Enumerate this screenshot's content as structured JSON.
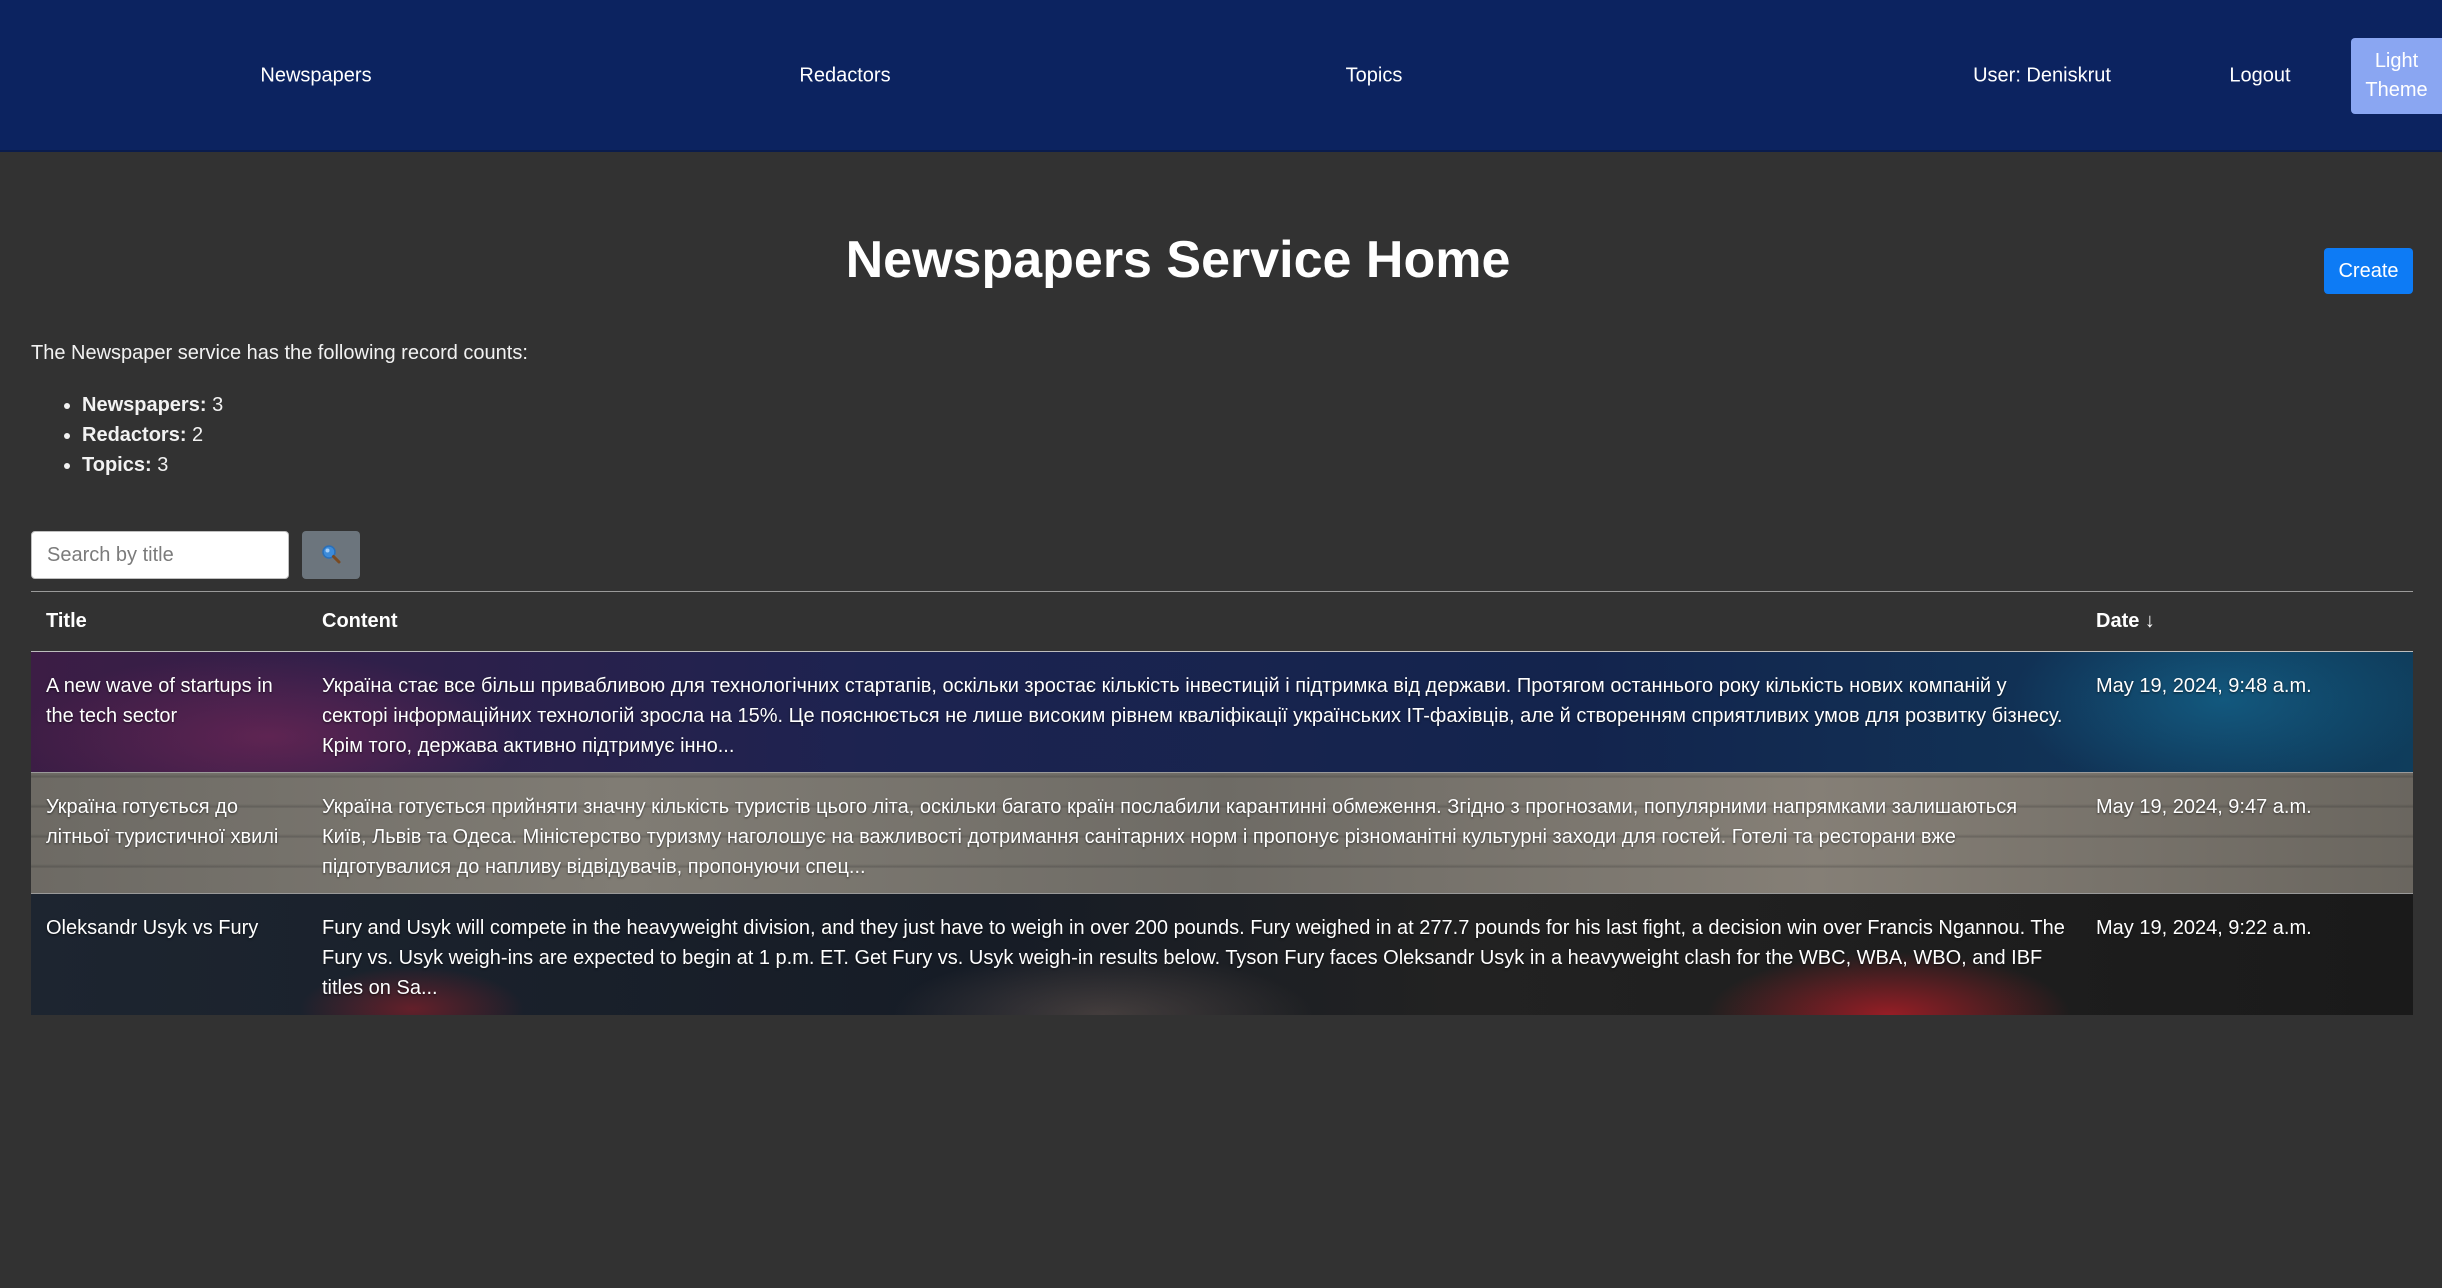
{
  "nav": {
    "newspapers": "Newspapers",
    "redactors": "Redactors",
    "topics": "Topics",
    "user": "User: Deniskrut",
    "logout": "Logout",
    "theme_line1": "Light",
    "theme_line2": "Theme"
  },
  "header": {
    "title": "Newspapers Service Home",
    "create": "Create"
  },
  "intro": "The Newspaper service has the following record counts:",
  "counts": [
    {
      "label": "Newspapers:",
      "value": "3"
    },
    {
      "label": "Redactors:",
      "value": "2"
    },
    {
      "label": "Topics:",
      "value": "3"
    }
  ],
  "search": {
    "placeholder": "Search by title",
    "button_icon": "search-icon"
  },
  "table": {
    "columns": [
      "Title",
      "Content",
      "Date ↓"
    ],
    "rows": [
      {
        "title": "A new wave of startups in the tech sector",
        "content": "Україна стає все більш привабливою для технологічних стартапів, оскільки зростає кількість інвестицій і підтримка від держави. Протягом останнього року кількість нових компаній у секторі інформаційних технологій зросла на 15%. Це пояснюється не лише високим рівнем кваліфікації українських IT-фахівців, але й створенням сприятливих умов для розвитку бізнесу. Крім того, держава активно підтримує інно...",
        "date": "May 19, 2024, 9:48 a.m."
      },
      {
        "title": "Україна готується до літньої туристичної хвилі",
        "content": "Україна готується прийняти значну кількість туристів цього літа, оскільки багато країн послабили карантинні обмеження. Згідно з прогнозами, популярними напрямками залишаються Київ, Львів та Одеса. Міністерство туризму наголошує на важливості дотримання санітарних норм і пропонує різноманітні культурні заходи для гостей. Готелі та ресторани вже підготувалися до напливу відвідувачів, пропонуючи спец...",
        "date": "May 19, 2024, 9:47 a.m."
      },
      {
        "title": "Oleksandr Usyk vs Fury",
        "content": "Fury and Usyk will compete in the heavyweight division, and they just have to weigh in over 200 pounds. Fury weighed in at 277.7 pounds for his last fight, a decision win over Francis Ngannou. The Fury vs. Usyk weigh-ins are expected to begin at 1 p.m. ET. Get Fury vs. Usyk weigh-in results below. Tyson Fury faces Oleksandr Usyk in a heavyweight clash for the WBC, WBA, WBO, and IBF titles on Sa...",
        "date": "May 19, 2024, 9:22 a.m."
      }
    ]
  }
}
